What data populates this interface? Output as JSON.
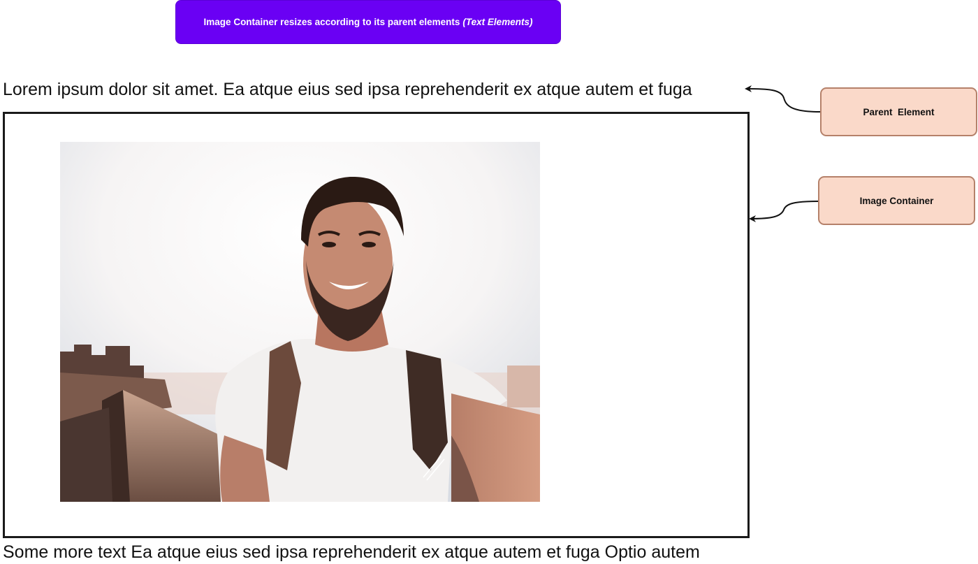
{
  "banner": {
    "text": "Image Container resizes according to its parent elements",
    "emphasis": "(Text Elements)",
    "color": "#6a00f4"
  },
  "text_top": "Lorem ipsum dolor sit amet. Ea atque eius sed ipsa reprehenderit ex atque autem et fuga",
  "text_bottom": "Some more text Ea atque eius sed ipsa reprehenderit ex atque autem et fuga Optio autem",
  "callouts": {
    "parent_element": "Parent  Element",
    "image_container": "Image Container",
    "fill_color": "#fad9c9",
    "border_color": "#b5816a"
  },
  "photo": {
    "subject": "selfie-man-white-tshirt-backpack"
  }
}
